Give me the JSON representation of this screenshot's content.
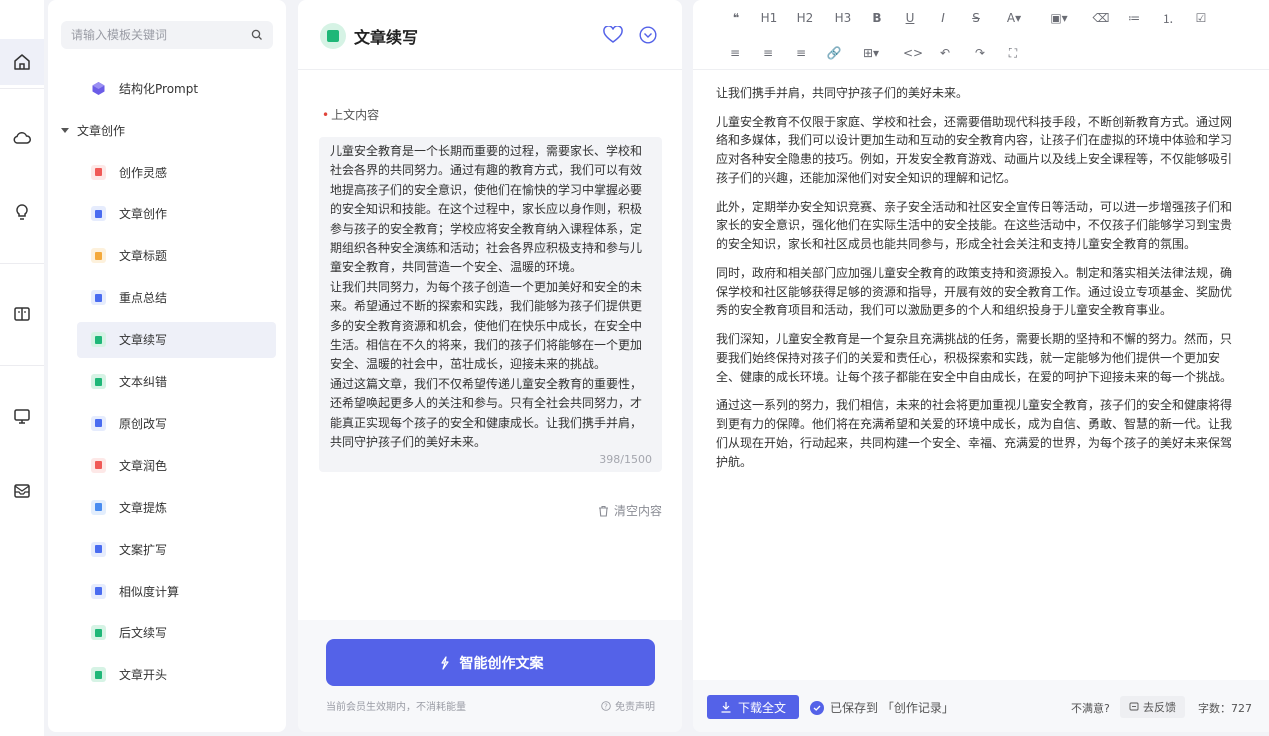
{
  "rail": {
    "items": [
      {
        "name": "home-icon",
        "active": true
      },
      {
        "name": "cloud-icon",
        "active": false
      },
      {
        "name": "bulb-icon",
        "active": false
      },
      {
        "name": "book-icon",
        "active": false
      },
      {
        "name": "monitor-icon",
        "active": false
      },
      {
        "name": "mail-icon",
        "active": false
      }
    ]
  },
  "templates": {
    "search_placeholder": "请输入模板关键词",
    "top_item": "结构化Prompt",
    "category": "文章创作",
    "items": [
      {
        "label": "创作灵感",
        "color": "#f05a57",
        "bg": "#fde8e7"
      },
      {
        "label": "文章创作",
        "color": "#4a6cf0",
        "bg": "#e6ecfd"
      },
      {
        "label": "文章标题",
        "color": "#f4a93b",
        "bg": "#fdf1dc"
      },
      {
        "label": "重点总结",
        "color": "#4a6cf0",
        "bg": "#e6ecfd"
      },
      {
        "label": "文章续写",
        "color": "#1fb778",
        "bg": "#d6f3e5"
      },
      {
        "label": "文本纠错",
        "color": "#1fb778",
        "bg": "#d6f3e5"
      },
      {
        "label": "原创改写",
        "color": "#4a6cf0",
        "bg": "#e6ecfd"
      },
      {
        "label": "文章润色",
        "color": "#f05a57",
        "bg": "#fde8e7"
      },
      {
        "label": "文章提炼",
        "color": "#4a8cf0",
        "bg": "#e3eefd"
      },
      {
        "label": "文案扩写",
        "color": "#4a6cf0",
        "bg": "#e6ecfd"
      },
      {
        "label": "相似度计算",
        "color": "#4a6cf0",
        "bg": "#e6ecfd"
      },
      {
        "label": "后文续写",
        "color": "#1fb778",
        "bg": "#d6f3e5"
      },
      {
        "label": "文章开头",
        "color": "#1fb778",
        "bg": "#d6f3e5"
      }
    ]
  },
  "middle": {
    "title": "文章续写",
    "field_label": "上文内容",
    "field_text": "儿童安全教育是一个长期而重要的过程，需要家长、学校和社会各界的共同努力。通过有趣的教育方式，我们可以有效地提高孩子们的安全意识，使他们在愉快的学习中掌握必要的安全知识和技能。在这个过程中，家长应以身作则，积极参与孩子的安全教育；学校应将安全教育纳入课程体系，定期组织各种安全演练和活动；社会各界应积极支持和参与儿童安全教育，共同营造一个安全、温暖的环境。\n让我们共同努力，为每个孩子创造一个更加美好和安全的未来。希望通过不断的探索和实践，我们能够为孩子们提供更多的安全教育资源和机会，使他们在快乐中成长，在安全中生活。相信在不久的将来，我们的孩子们将能够在一个更加安全、温暖的社会中，茁壮成长，迎接未来的挑战。\n通过这篇文章，我们不仅希望传递儿童安全教育的重要性，还希望唤起更多人的关注和参与。只有全社会共同努力，才能真正实现每个孩子的安全和健康成长。让我们携手并肩，共同守护孩子们的美好未来。",
    "char_count": "398/1500",
    "clear_label": "清空内容",
    "generate_label": "智能创作文案",
    "footer_note": "当前会员生效期内，不消耗能量",
    "disclaimer": "免责声明"
  },
  "editor": {
    "toolbar_row1": [
      "❝",
      "H1",
      "H2",
      "H3",
      "B",
      "U",
      "I",
      "S",
      "A▾",
      "▣▾",
      "⌫",
      "≔",
      "⒈",
      "☑"
    ],
    "toolbar_row2": [
      "≡",
      "≡",
      "≡",
      "🔗",
      "⊞▾",
      "<>",
      "↶",
      "↷",
      "⛶"
    ],
    "paragraphs": [
      "让我们携手并肩，共同守护孩子们的美好未来。",
      "儿童安全教育不仅限于家庭、学校和社会，还需要借助现代科技手段，不断创新教育方式。通过网络和多媒体，我们可以设计更加生动和互动的安全教育内容，让孩子们在虚拟的环境中体验和学习应对各种安全隐患的技巧。例如，开发安全教育游戏、动画片以及线上安全课程等，不仅能够吸引孩子们的兴趣，还能加深他们对安全知识的理解和记忆。",
      "此外，定期举办安全知识竞赛、亲子安全活动和社区安全宣传日等活动，可以进一步增强孩子们和家长的安全意识，强化他们在实际生活中的安全技能。在这些活动中，不仅孩子们能够学习到宝贵的安全知识，家长和社区成员也能共同参与，形成全社会关注和支持儿童安全教育的氛围。",
      "同时，政府和相关部门应加强儿童安全教育的政策支持和资源投入。制定和落实相关法律法规，确保学校和社区能够获得足够的资源和指导，开展有效的安全教育工作。通过设立专项基金、奖励优秀的安全教育项目和活动，我们可以激励更多的个人和组织投身于儿童安全教育事业。",
      "我们深知，儿童安全教育是一个复杂且充满挑战的任务，需要长期的坚持和不懈的努力。然而，只要我们始终保持对孩子们的关爱和责任心，积极探索和实践，就一定能够为他们提供一个更加安全、健康的成长环境。让每个孩子都能在安全中自由成长，在爱的呵护下迎接未来的每一个挑战。",
      "通过这一系列的努力，我们相信，未来的社会将更加重视儿童安全教育，孩子们的安全和健康将得到更有力的保障。他们将在充满希望和关爱的环境中成长，成为自信、勇敢、智慧的新一代。让我们从现在开始，行动起来，共同构建一个安全、幸福、充满爱的世界，为每个孩子的美好未来保驾护航。"
    ],
    "download_label": "下载全文",
    "saved_label": "已保存到 「创作记录」",
    "unsatisfied_label": "不满意?",
    "feedback_label": "去反馈",
    "word_count_label": "字数：727"
  },
  "colors": {
    "accent": "#5462e8",
    "active_bg": "#eef0f8"
  }
}
